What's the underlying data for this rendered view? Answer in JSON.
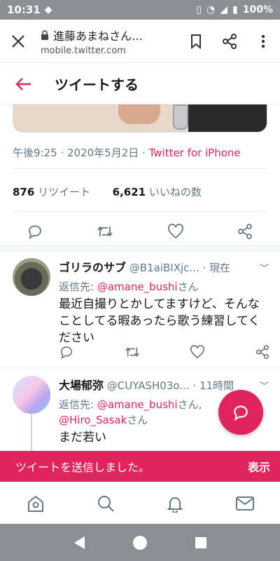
{
  "status_bar": {
    "time": "10:31",
    "battery": "100%"
  },
  "browser": {
    "title": "進藤あまねさん…",
    "domain": "mobile.twitter.com"
  },
  "header": {
    "title": "ツイートする"
  },
  "tweet": {
    "time": "午後9:25",
    "date": "2020年5月2日",
    "source": "Twitter for iPhone",
    "retweets_count": "876",
    "retweets_label": "リツイート",
    "likes_count": "6,621",
    "likes_label": "いいねの数"
  },
  "replies": [
    {
      "name": "ゴリラのサブ",
      "handle": "@B1aiBIXjc...",
      "time": "· 現在",
      "reply_to_prefix": "返信先: ",
      "mentions": [
        "@amane_bushi"
      ],
      "mention_suffix": "さん",
      "text": "最近自撮りとかしてますけど、そんなことしてる暇あったら歌う練習してください"
    },
    {
      "name": "大場郁弥",
      "handle": "@CUYASH03o...",
      "time": "· 11時間",
      "reply_to_prefix": "返信先: ",
      "mentions": [
        "@amane_bushi",
        "@Hiro_Sasak"
      ],
      "mention_suffix_1": "さん, ",
      "mention_suffix_2": "さん",
      "text": "まだ若い"
    }
  ],
  "toast": {
    "message": "ツイートを送信しました。",
    "action": "表示"
  },
  "colors": {
    "accent": "#e0245e",
    "secondary_text": "#657786",
    "system_bar": "#8a8f94"
  }
}
